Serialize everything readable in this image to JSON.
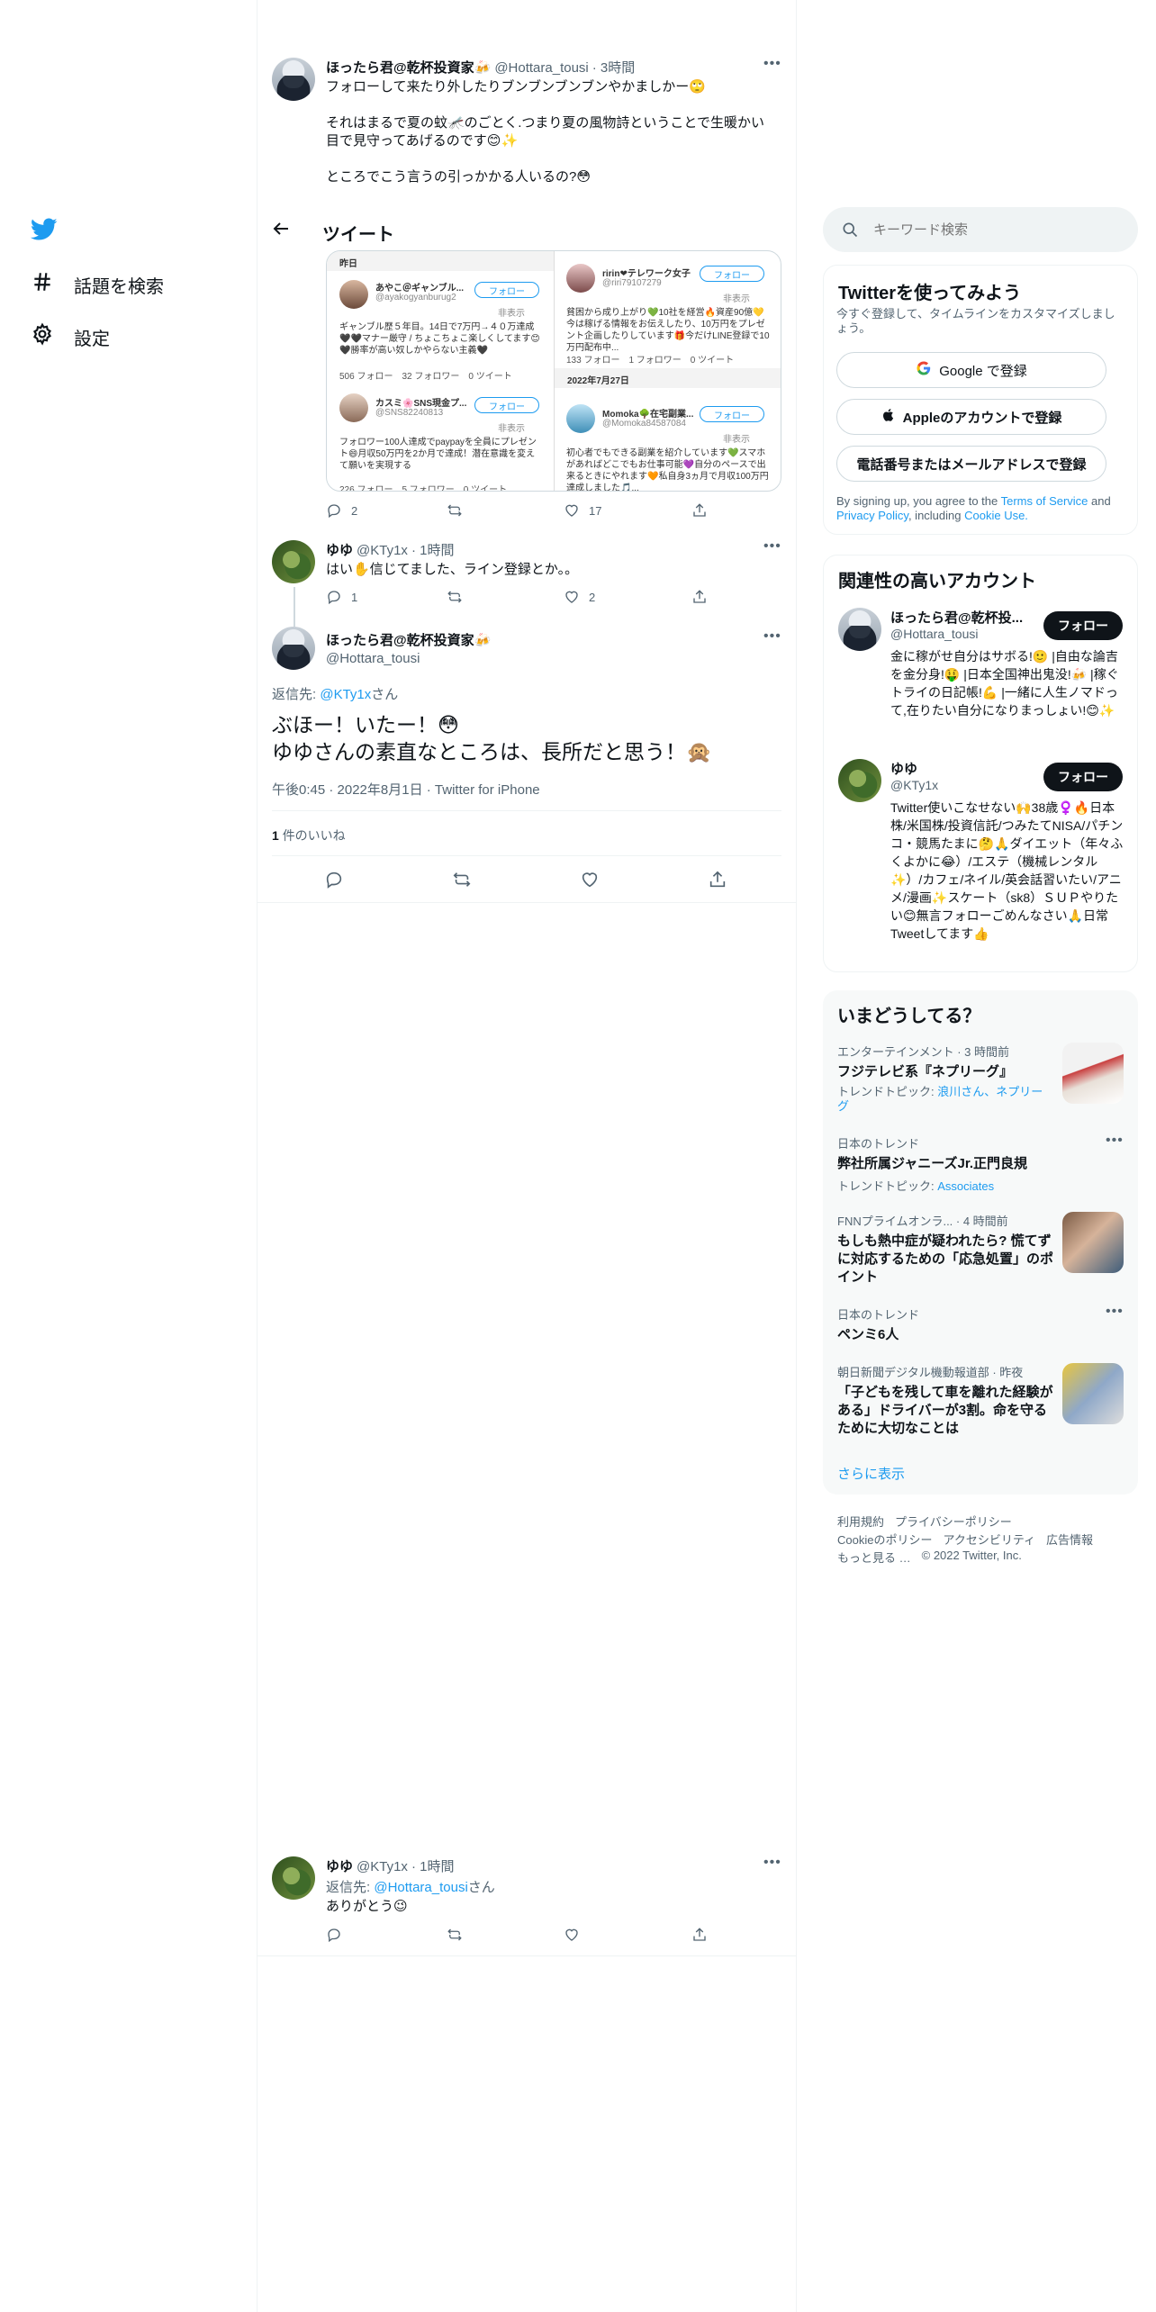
{
  "nav": {
    "explore_label": "話題を検索",
    "settings_label": "設定"
  },
  "header": {
    "back_icon": "back-arrow-icon",
    "title": "ツイート"
  },
  "tweets": [
    {
      "name": "ほったら君@乾杯投資家🍻",
      "handle": "@Hottara_tousi",
      "time": "· 3時間",
      "lines": [
        "フォローして来たり外したりブンブンブンブンやかましかー🙄",
        "",
        "それはまるで夏の蚊🦟のごとく.つまり夏の風物詩ということで生暖かい目で見守ってあげるのです😊✨",
        "",
        "ところでこう言うの引っかかる人いるの?😳"
      ],
      "replies": "2",
      "retweets": "",
      "likes": "17"
    },
    {
      "name": "ゆゆ",
      "handle": "@KTy1x",
      "time": "· 1時間",
      "text": "はい✋信じてました、ライン登録とか。。",
      "replies": "1",
      "retweets": "",
      "likes": "2"
    }
  ],
  "embed": {
    "col1_header": "昨日",
    "col2_date": "2022年7月27日",
    "follow": "フォロー",
    "hide": "非表示",
    "users": [
      {
        "name": "あやこ＠ギャンブル...",
        "handle": "@ayakogyanburug2",
        "text": "ギャンブル歴５年目。14日で7万円→４０万達成🖤🖤マナー厳守 / ちょこちょこ楽しくしてます😊🖤勝率が高い奴しかやらない主義🖤",
        "stats": "506 フォロー　32 フォロワー　0 ツイート"
      },
      {
        "name": "カスミ🌸SNS現金プ...",
        "handle": "@SNS82240813",
        "text": "フォロワー100人達成でpaypayを全員にプレゼント😄月収50万円を2か月で達成！潜在意識を変えて願いを実現する",
        "stats": "226 フォロー　5 フォロワー　0 ツイート"
      },
      {
        "name": "ririn❤テレワーク女子",
        "handle": "@riri79107279",
        "text": "貧困から成り上がり💚10社を経営🔥資産90億💛今は稼げる情報をお伝えしたり、10万円をプレゼント企画したりしています🎁今だけLINE登録で10万円配布中...",
        "stats": "133 フォロー　1 フォロワー　0 ツイート"
      },
      {
        "name": "Momoka🌳在宅副業...",
        "handle": "@Momoka84587084",
        "text": "初心者でもできる副業を紹介しています💚スマホがあればどこでもお仕事可能💜自分のペースで出来るときにやれます🧡私自身3ヵ月で月収100万円達成しました🎵...",
        "stats": ""
      }
    ]
  },
  "main_tweet": {
    "name": "ほったら君@乾杯投資家🍻",
    "handle": "@Hottara_tousi",
    "reply_prefix": "返信先: ",
    "reply_to": "@KTy1x",
    "reply_suffix": "さん",
    "line1": "ぶほー！いたー！😳",
    "line2": "ゆゆさんの素直なところは、長所だと思う！🙊",
    "meta": "午後0:45 · 2022年8月1日 · Twitter for iPhone",
    "likes_count": "1",
    "likes_label": "件のいいね"
  },
  "reply_tweet": {
    "name": "ゆゆ",
    "handle": "@KTy1x",
    "time": "· 1時間",
    "reply_prefix": "返信先: ",
    "reply_to": "@Hottara_tousi",
    "reply_suffix": "さん",
    "text": "ありがとう😉"
  },
  "search": {
    "placeholder": "キーワード検索"
  },
  "signup": {
    "title": "Twitterを使ってみよう",
    "subtitle": "今すぐ登録して、タイムラインをカスタマイズしましょう。",
    "google": "Google で登録",
    "apple": "Appleのアカウントで登録",
    "phone": "電話番号またはメールアドレスで登録",
    "terms_prefix": "By signing up, you agree to the ",
    "terms": "Terms of Service",
    "and": " and ",
    "privacy": "Privacy Policy",
    "including": ", including ",
    "cookie": "Cookie Use."
  },
  "related": {
    "title": "関連性の高いアカウント",
    "follow": "フォロー",
    "accounts": [
      {
        "name": "ほったら君@乾杯投...",
        "handle": "@Hottara_tousi",
        "bio": "金に稼がせ自分はサボる!🙂 |自由な論吉を金分身!🤑 |日本全国神出鬼没!🍻 |稼ぐトライの日記帳!💪 |一緒に人生ノマドって,在りたい自分になりまっしょい!😊✨"
      },
      {
        "name": "ゆゆ",
        "handle": "@KTy1x",
        "bio": "Twitter使いこなせない🙌38歳♀️🔥日本株/米国株/投資信託/つみたてNISA/パチンコ・競馬たまに🤔🙏ダイエット（年々ふくよかに😂）/エステ（機械レンタル✨）/カフェ/ネイル/英会話習いたい/アニメ/漫画✨スケート（sk8）ＳＵＰやりたい😊無言フォローごめんなさい🙏日常Tweetしてます👍"
      }
    ]
  },
  "trends": {
    "title": "いまどうしてる？",
    "items": [
      {
        "category": "エンターテインメント · 3 時間前",
        "title": "フジテレビ系『ネプリーグ』",
        "topic_prefix": "トレンドトピック: ",
        "topic": "浪川さん、ネプリーグ"
      },
      {
        "category": "日本のトレンド",
        "title": "弊社所属ジャニーズJr.正門良規",
        "topic_prefix": "トレンドトピック: ",
        "topic": "Associates"
      },
      {
        "category": "FNNプライムオンラ... · 4 時間前",
        "title": "もしも熱中症が疑われたら? 慌てずに対応するための「応急処置」のポイント"
      },
      {
        "category": "日本のトレンド",
        "title": "ペンミ6人"
      },
      {
        "category": "朝日新聞デジタル機動報道部 · 昨夜",
        "title": "「子どもを残して車を離れた経験がある」ドライバーが3割。命を守るために大切なことは"
      }
    ],
    "more": "さらに表示"
  },
  "footer": {
    "row1": [
      "利用規約",
      "プライバシーポリシー"
    ],
    "row2": [
      "Cookieのポリシー",
      "アクセシビリティ",
      "広告情報"
    ],
    "row3": [
      "もっと見る …",
      "© 2022 Twitter, Inc."
    ]
  },
  "colors": {
    "accent": "#1d9bf0",
    "text": "#0f1419",
    "muted": "#536471"
  }
}
